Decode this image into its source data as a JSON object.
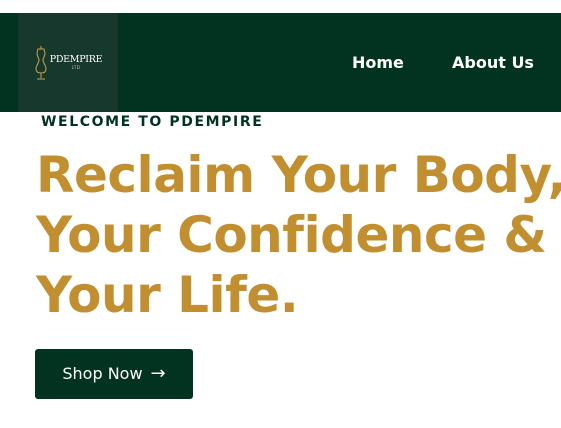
{
  "navbar": {
    "logo": {
      "name": "PDEMPIRE",
      "suffix": "LTD",
      "icon": "dress-form-icon"
    },
    "links": [
      {
        "label": "Home"
      },
      {
        "label": "About Us"
      }
    ]
  },
  "hero": {
    "eyebrow": "WELCOME TO PDEMPIRE",
    "headline_lines": [
      "Reclaim Your Body,",
      "Your Confidence &",
      "Your Life."
    ],
    "cta": {
      "label": "Shop Now",
      "icon": "arrow-right-icon",
      "glyph": "→"
    }
  },
  "colors": {
    "nav_background": "#023321",
    "logo_background": "#17392d",
    "accent_gold": "#c18f2f",
    "dark_green_text": "#023321",
    "white": "#ffffff"
  }
}
